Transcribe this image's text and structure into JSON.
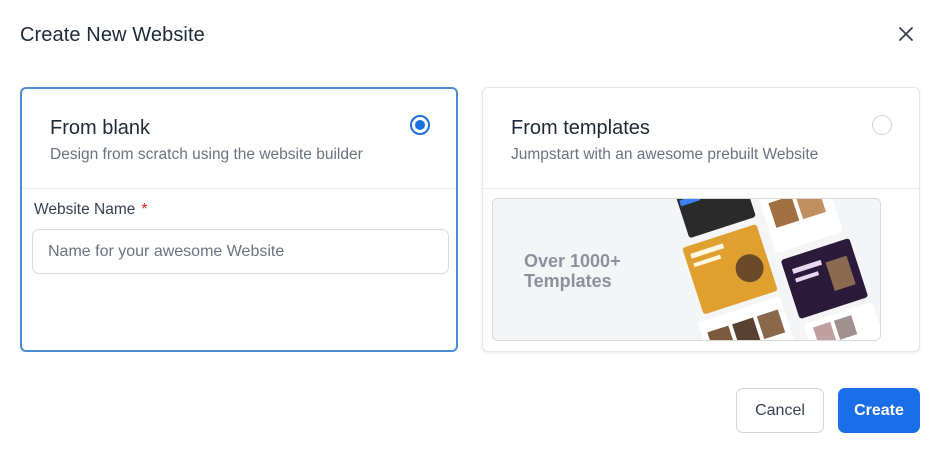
{
  "dialog": {
    "title": "Create New Website",
    "close_icon": "close-icon"
  },
  "options": {
    "blank": {
      "title": "From blank",
      "subtitle": "Design from scratch using the website builder",
      "selected": true,
      "field_label": "Website Name",
      "required_mark": "*",
      "input_placeholder": "Name for your awesome Website",
      "input_value": ""
    },
    "templates": {
      "title": "From templates",
      "subtitle": "Jumpstart with an awesome prebuilt Website",
      "selected": false,
      "preview_text": "Over 1000+ Templates"
    }
  },
  "actions": {
    "cancel_label": "Cancel",
    "create_label": "Create"
  },
  "colors": {
    "accent": "#1a6ee8",
    "selected_border": "#4a8fd6",
    "required": "#dc2626"
  }
}
